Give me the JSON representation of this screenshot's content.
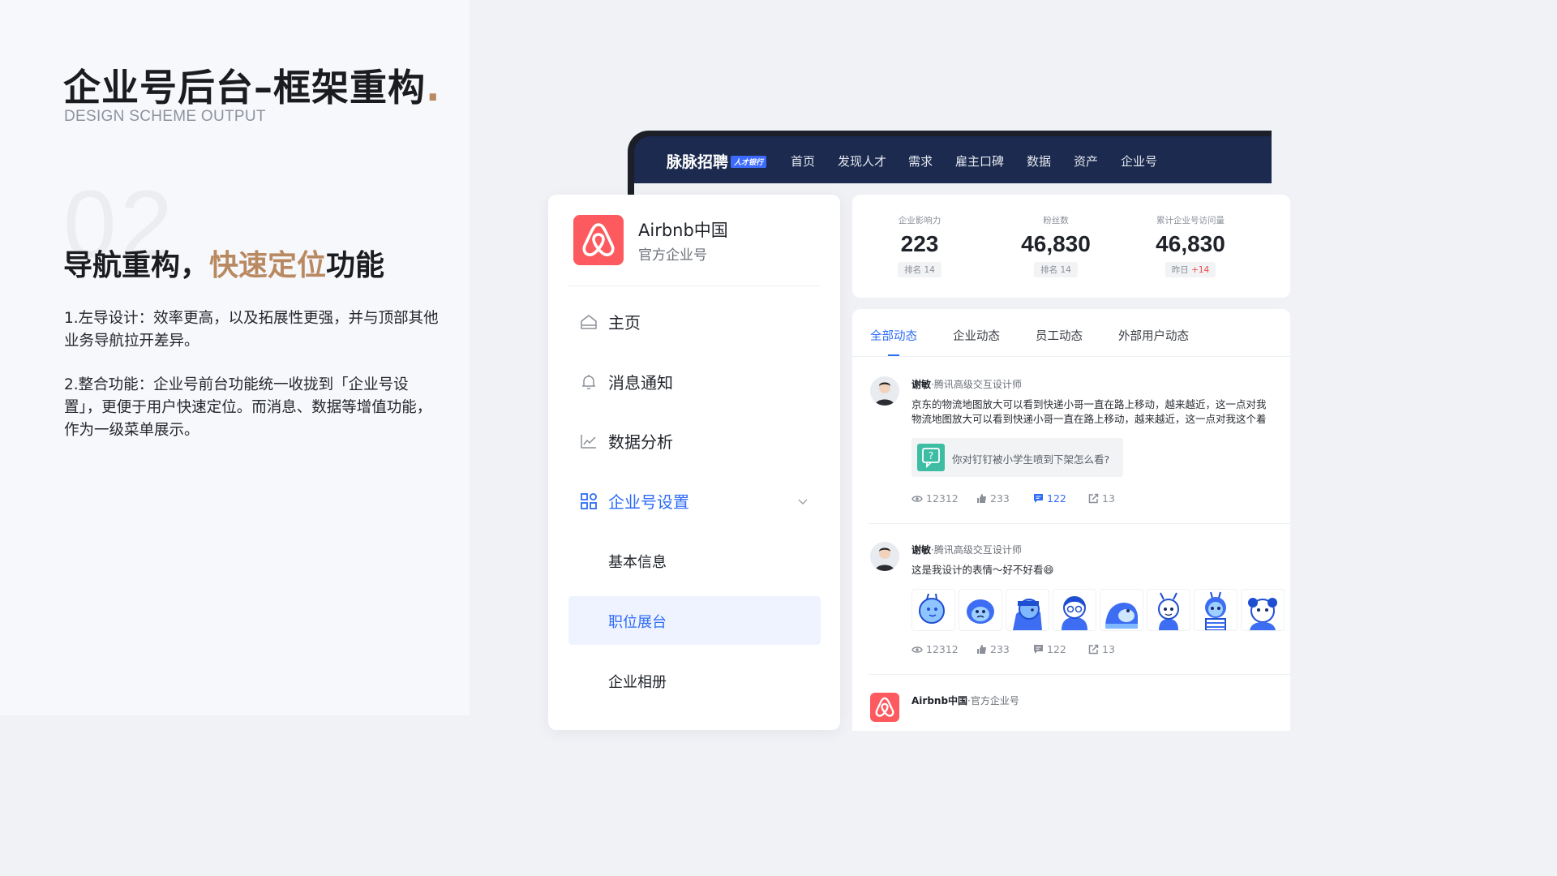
{
  "slide": {
    "title": "企业号后台–框架重构",
    "title_dot": ".",
    "subtitle": "DESIGN SCHEME OUTPUT",
    "section_number": "02",
    "heading_pre": "导航重构，",
    "heading_highlight": "快速定位",
    "heading_post": "功能",
    "paragraph1": "1.左导设计：效率更高，以及拓展性更强，并与顶部其他业务导航拉开差异。",
    "paragraph2": "2.整合功能：企业号前台功能统一收拢到「企业号设置」，更便于用户快速定位。而消息、数据等增值功能，作为一级菜单展示。",
    "accent_color": "#b98a62"
  },
  "app": {
    "brand": "脉脉招聘",
    "brand_badge": "人才银行",
    "top_nav": [
      "首页",
      "发现人才",
      "需求",
      "雇主口碑",
      "数据",
      "资产",
      "企业号"
    ],
    "sidebar": {
      "org_name": "Airbnb中国",
      "org_subtitle": "官方企业号",
      "menu": [
        {
          "label": "主页",
          "icon": "home-icon"
        },
        {
          "label": "消息通知",
          "icon": "bell-icon"
        },
        {
          "label": "数据分析",
          "icon": "chart-icon"
        },
        {
          "label": "企业号设置",
          "icon": "grid-icon",
          "expanded": true
        }
      ],
      "submenu": [
        "基本信息",
        "职位展台",
        "企业相册"
      ],
      "selected_submenu": "职位展台"
    },
    "stats": [
      {
        "label": "企业影响力",
        "value": "223",
        "badge": "排名 14"
      },
      {
        "label": "粉丝数",
        "value": "46,830",
        "badge": "排名 14"
      },
      {
        "label": "累计企业号访问量",
        "value": "46,830",
        "badge_prefix": "昨日",
        "badge_delta": "+14"
      }
    ],
    "feed": {
      "tabs": [
        "全部动态",
        "企业动态",
        "员工动态",
        "外部用户动态"
      ],
      "active_tab": "全部动态",
      "posts": [
        {
          "author": "谢敏",
          "author_title": "·腾讯高级交互设计师",
          "lines": [
            "京东的物流地图放大可以看到快递小哥一直在路上移动，越来越近，这一点对我",
            "物流地图放大可以看到快递小哥一直在路上移动，越来越近，这一点对我这个着"
          ],
          "quote": "你对钉钉被小学生喷到下架怎么看?",
          "views": "12312",
          "likes": "233",
          "comments": "122",
          "shares": "13"
        },
        {
          "author": "谢敏",
          "author_title": "·腾讯高级交互设计师",
          "lines": [
            "这是我设计的表情～好不好看😄"
          ],
          "views": "12312",
          "likes": "233",
          "comments": "122",
          "shares": "13"
        },
        {
          "author": "Airbnb中国",
          "author_title": "·官方企业号"
        }
      ]
    }
  }
}
